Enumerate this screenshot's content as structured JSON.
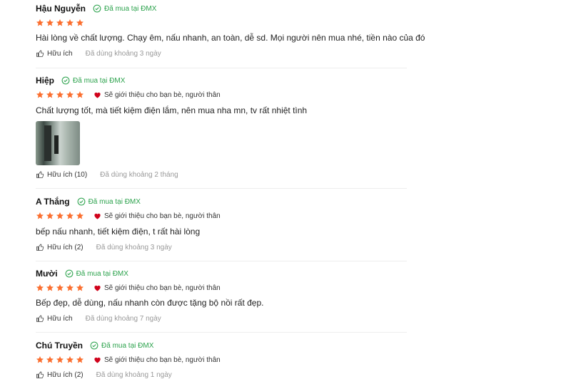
{
  "reviews": [
    {
      "name": "Hậu Nguyễn",
      "verified_label": "Đã mua tại ĐMX",
      "stars": 5,
      "recommend": "",
      "text": "Hài lòng về chất lượng. Chạy êm, nấu nhanh, an toàn, dễ sd. Mọi người nên mua nhé, tiền nào của đó",
      "helpful": "Hữu ích",
      "used": "Đã dùng khoảng 3 ngày"
    },
    {
      "name": "Hiệp",
      "verified_label": "Đã mua tại ĐMX",
      "stars": 5,
      "recommend": "Sẽ giới thiệu cho bạn bè, người thân",
      "text": "Chất lượng tốt, mà tiết kiệm điện lắm, nên mua nha mn, tv rất nhiệt tình",
      "helpful": "Hữu ích (10)",
      "used": "Đã dùng khoảng 2 tháng"
    },
    {
      "name": "A Thắng",
      "verified_label": "Đã mua tại ĐMX",
      "stars": 5,
      "recommend": "Sẽ giới thiệu cho bạn bè, người thân",
      "text": "bếp nấu nhanh, tiết kiệm điện, t rất hài lòng",
      "helpful": "Hữu ích (2)",
      "used": "Đã dùng khoảng 3 ngày"
    },
    {
      "name": "Mười",
      "verified_label": "Đã mua tại ĐMX",
      "stars": 5,
      "recommend": "Sẽ giới thiệu cho bạn bè, người thân",
      "text": "Bếp đẹp, dễ dùng, nấu nhanh còn được tặng bộ nồi rất đẹp.",
      "helpful": "Hữu ích",
      "used": "Đã dùng khoảng 7 ngày"
    },
    {
      "name": "Chú Truyền",
      "verified_label": "Đã mua tại ĐMX",
      "stars": 5,
      "recommend": "Sẽ giới thiệu cho bạn bè, người thân",
      "text": "",
      "helpful": "Hữu ích (2)",
      "used": "Đã dùng khoảng 1 ngày"
    }
  ],
  "colors": {
    "star": "#fb6e2e",
    "verified": "#2ba24c",
    "heart": "#d0021b",
    "muted": "#999999"
  },
  "icons": {
    "verified": "check-circle-icon",
    "star": "star-icon",
    "recommend": "heart-icon",
    "helpful": "thumbs-up-icon"
  }
}
